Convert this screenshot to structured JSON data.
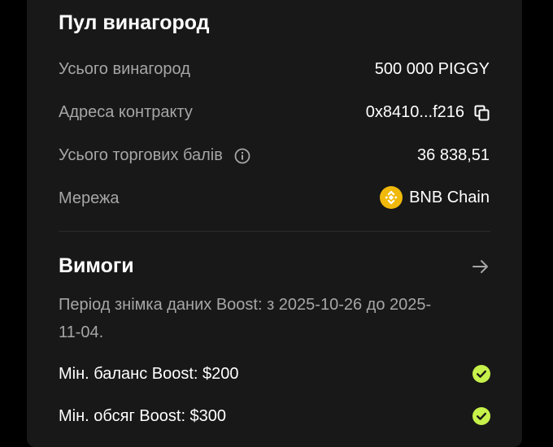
{
  "pool": {
    "title": "Пул винагород",
    "rows": {
      "total_rewards": {
        "label": "Усього винагород",
        "value": "500 000 PIGGY"
      },
      "contract_address": {
        "label": "Адреса контракту",
        "value": "0x8410...f216",
        "icon": "copy-icon"
      },
      "total_points": {
        "label": "Усього торгових балів",
        "value": "36 838,51",
        "icon": "info-icon"
      },
      "network": {
        "label": "Мережа",
        "value": "BNB Chain",
        "icon": "bnb-chain-logo"
      }
    }
  },
  "requirements": {
    "title": "Вимоги",
    "arrow_icon": "arrow-right-icon",
    "period": "Період знімка даних Boost: з 2025-10-26 до 2025-11-04.",
    "items": [
      {
        "label": "Мін. баланс Boost: $200",
        "status": "met",
        "icon": "check-circle-icon"
      },
      {
        "label": "Мін. обсяг Boost: $300",
        "status": "met",
        "icon": "check-circle-icon"
      }
    ]
  },
  "colors": {
    "background": "#000000",
    "card": "#181818",
    "text_primary": "#ffffff",
    "text_secondary": "#a6a6a6",
    "check_green": "#c6f04a",
    "bnb_yellow": "#f0b90b"
  }
}
